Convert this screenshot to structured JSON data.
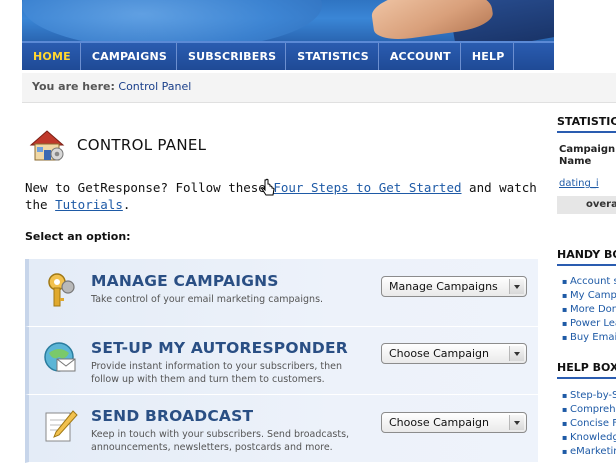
{
  "nav": {
    "items": [
      {
        "label": "HOME",
        "active": true
      },
      {
        "label": "CAMPAIGNS"
      },
      {
        "label": "SUBSCRIBERS"
      },
      {
        "label": "STATISTICS"
      },
      {
        "label": "ACCOUNT"
      },
      {
        "label": "HELP"
      }
    ]
  },
  "breadcrumb": {
    "prefix": "You are here:",
    "current": "Control Panel"
  },
  "page": {
    "title": "CONTROL PANEL",
    "intro_before": "New to GetResponse? Follow these ",
    "intro_link": "Four Steps to Get Started",
    "intro_middle": " and watch the ",
    "tutorials_link": "Tutorials",
    "intro_end": ".",
    "select_label": "Select an option:"
  },
  "options": [
    {
      "title": "MANAGE CAMPAIGNS",
      "desc": "Take control of your email marketing campaigns.",
      "dropdown": "Manage Campaigns",
      "icon": "keys-icon"
    },
    {
      "title": "SET-UP MY AUTORESPONDER",
      "desc": "Provide instant information to your subscribers, then follow up with them and turn them to customers.",
      "dropdown": "Choose Campaign",
      "icon": "autoresponder-icon"
    },
    {
      "title": "SEND BROADCAST",
      "desc": "Keep in touch with your subscribers. Send broadcasts, announcements, newsletters, postcards and more.",
      "dropdown": "Choose Campaign",
      "icon": "broadcast-icon"
    }
  ],
  "sidebar": {
    "statistics": {
      "title": "STATISTICS",
      "col_header_1": "Campaign",
      "col_header_2": "Name",
      "row_campaign": "dating_i",
      "overall": "overa"
    },
    "handy_box": {
      "title": "HANDY BO",
      "items": [
        "Account s",
        "My Campa",
        "More Dom",
        "Power Lea",
        "Buy Email"
      ]
    },
    "help_box": {
      "title": "HELP BOX",
      "items": [
        "Step-by-S",
        "Comprehe",
        "Concise F",
        "Knowledge",
        "eMarketin"
      ]
    }
  },
  "colors": {
    "nav_bg": "#1f4a96",
    "nav_active": "#ffd630",
    "option_title": "#2a4f84",
    "link": "#1e5aa6"
  }
}
